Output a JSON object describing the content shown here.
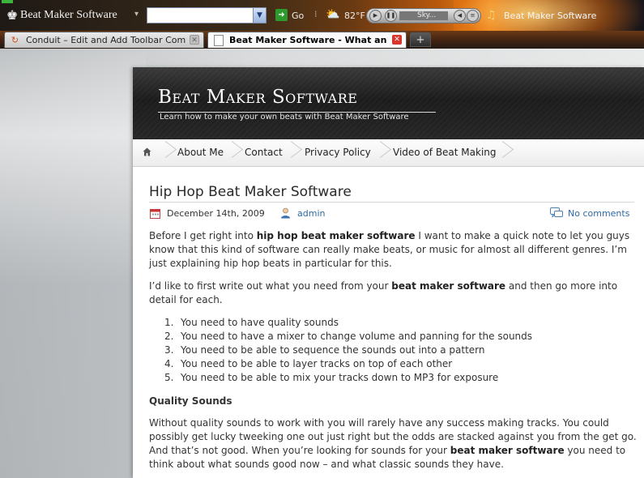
{
  "toolbar": {
    "title": "Beat Maker Software",
    "search_value": "",
    "go_label": "Go",
    "temperature": "82°F",
    "player_text": "Sky...",
    "right_label": "Beat Maker Software"
  },
  "tabs": [
    {
      "label": "Conduit – Edit and Add Toolbar Compo...",
      "active": false
    },
    {
      "label": "Beat Maker Software - What an e...",
      "active": true
    }
  ],
  "new_tab_label": "+",
  "site": {
    "title": "Beat Maker Software",
    "tagline": "Learn how to make your own beats with Beat Maker Software",
    "nav": [
      "About Me",
      "Contact",
      "Privacy Policy",
      "Video of Beat Making"
    ]
  },
  "post": {
    "title": "Hip Hop Beat Maker Software",
    "date": "December 14th, 2009",
    "author": "admin",
    "comments": "No comments",
    "p1_a": "Before I get right into ",
    "p1_bold": "hip hop beat maker software",
    "p1_b": " I want to make a quick note to let you guys know that this kind of software can really make beats, or music for almost all different genres.  I’m just explaining hip hop beats in particular for this.",
    "p2_a": "I’d like to first write out what you need from your ",
    "p2_bold": "beat maker software",
    "p2_b": " and then go more into detail for each.",
    "list": [
      "You need to have quality sounds",
      "You need to have a mixer to change volume and panning for the sounds",
      "You need to be able to sequence the sounds out into a pattern",
      "You need to be able to layer tracks on top of each other",
      "You need to be able to mix your tracks down to MP3 for exposure"
    ],
    "h_quality": "Quality Sounds",
    "p3_a": "Without quality sounds to work with you will rarely have any success making tracks.  You could possibly get lucky tweeking one out just right but the odds are stacked against you from the get go.  And that’s not good. When you’re looking for sounds for your ",
    "p3_bold": "beat maker software",
    "p3_b": " you need to think about what sounds good now – and what classic sounds they have."
  }
}
